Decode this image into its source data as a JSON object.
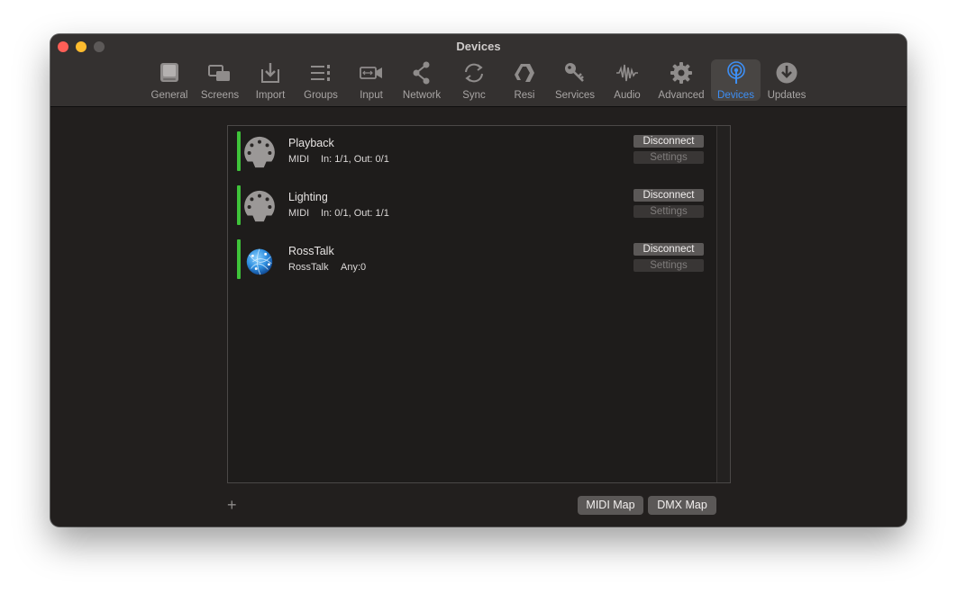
{
  "window": {
    "title": "Devices"
  },
  "toolbar": {
    "items": [
      {
        "label": "General",
        "icon": "general-icon"
      },
      {
        "label": "Screens",
        "icon": "screens-icon"
      },
      {
        "label": "Import",
        "icon": "import-icon"
      },
      {
        "label": "Groups",
        "icon": "groups-icon"
      },
      {
        "label": "Input",
        "icon": "input-icon"
      },
      {
        "label": "Network",
        "icon": "network-icon"
      },
      {
        "label": "Sync",
        "icon": "sync-icon"
      },
      {
        "label": "Resi",
        "icon": "resi-icon"
      },
      {
        "label": "Services",
        "icon": "key-icon"
      },
      {
        "label": "Audio",
        "icon": "audio-waveform-icon"
      },
      {
        "label": "Advanced",
        "icon": "gear-icon"
      },
      {
        "label": "Devices",
        "icon": "antenna-icon",
        "active": true
      },
      {
        "label": "Updates",
        "icon": "download-icon"
      }
    ]
  },
  "devices": [
    {
      "name": "Playback",
      "type": "MIDI",
      "port": "In: 1/1, Out: 0/1",
      "icon": "midi-connector-icon",
      "status_color": "#3fc33a"
    },
    {
      "name": "Lighting",
      "type": "MIDI",
      "port": "In: 0/1, Out: 1/1",
      "icon": "midi-connector-icon",
      "status_color": "#3fc33a"
    },
    {
      "name": "RossTalk",
      "type": "RossTalk",
      "port": "Any:0",
      "icon": "network-globe-icon",
      "status_color": "#3fc33a"
    }
  ],
  "row_buttons": {
    "disconnect": "Disconnect",
    "settings": "Settings"
  },
  "footer": {
    "add": "+",
    "midi_map": "MIDI Map",
    "dmx_map": "DMX Map"
  },
  "colors": {
    "accent": "#3d8ff5",
    "connected": "#3fc33a"
  }
}
